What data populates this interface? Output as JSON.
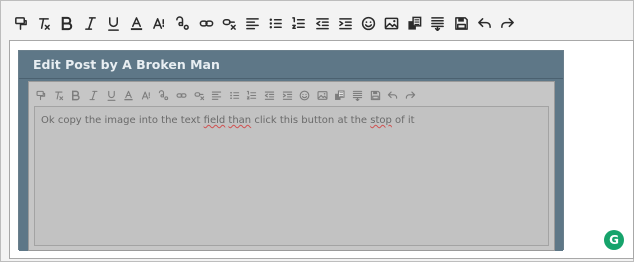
{
  "toolbar": {
    "buttons": [
      {
        "name": "format-painter-icon"
      },
      {
        "name": "clear-formatting-icon"
      },
      {
        "name": "bold-icon"
      },
      {
        "name": "italic-icon"
      },
      {
        "name": "underline-icon"
      },
      {
        "name": "font-color-icon"
      },
      {
        "name": "font-size-icon"
      },
      {
        "name": "subscript-icon"
      },
      {
        "name": "link-icon"
      },
      {
        "name": "unlink-icon"
      },
      {
        "name": "align-left-icon"
      },
      {
        "name": "bullet-list-icon"
      },
      {
        "name": "numbered-list-icon"
      },
      {
        "name": "decrease-indent-icon"
      },
      {
        "name": "increase-indent-icon"
      },
      {
        "name": "emoji-icon"
      },
      {
        "name": "insert-image-icon"
      },
      {
        "name": "copy-format-icon"
      },
      {
        "name": "remove-format-icon"
      },
      {
        "name": "save-icon"
      },
      {
        "name": "undo-icon"
      },
      {
        "name": "redo-icon"
      }
    ]
  },
  "embedded_screenshot": {
    "title": "Edit Post by A Broken Man",
    "text_before": "Ok copy the image into the text ",
    "text_field": "field",
    "text_mid1": " ",
    "text_than": "than",
    "text_mid2": " click this button at the ",
    "text_stop": "stop",
    "text_after": " of it"
  },
  "grammarly": {
    "label": "G",
    "color": "#16a36b"
  }
}
